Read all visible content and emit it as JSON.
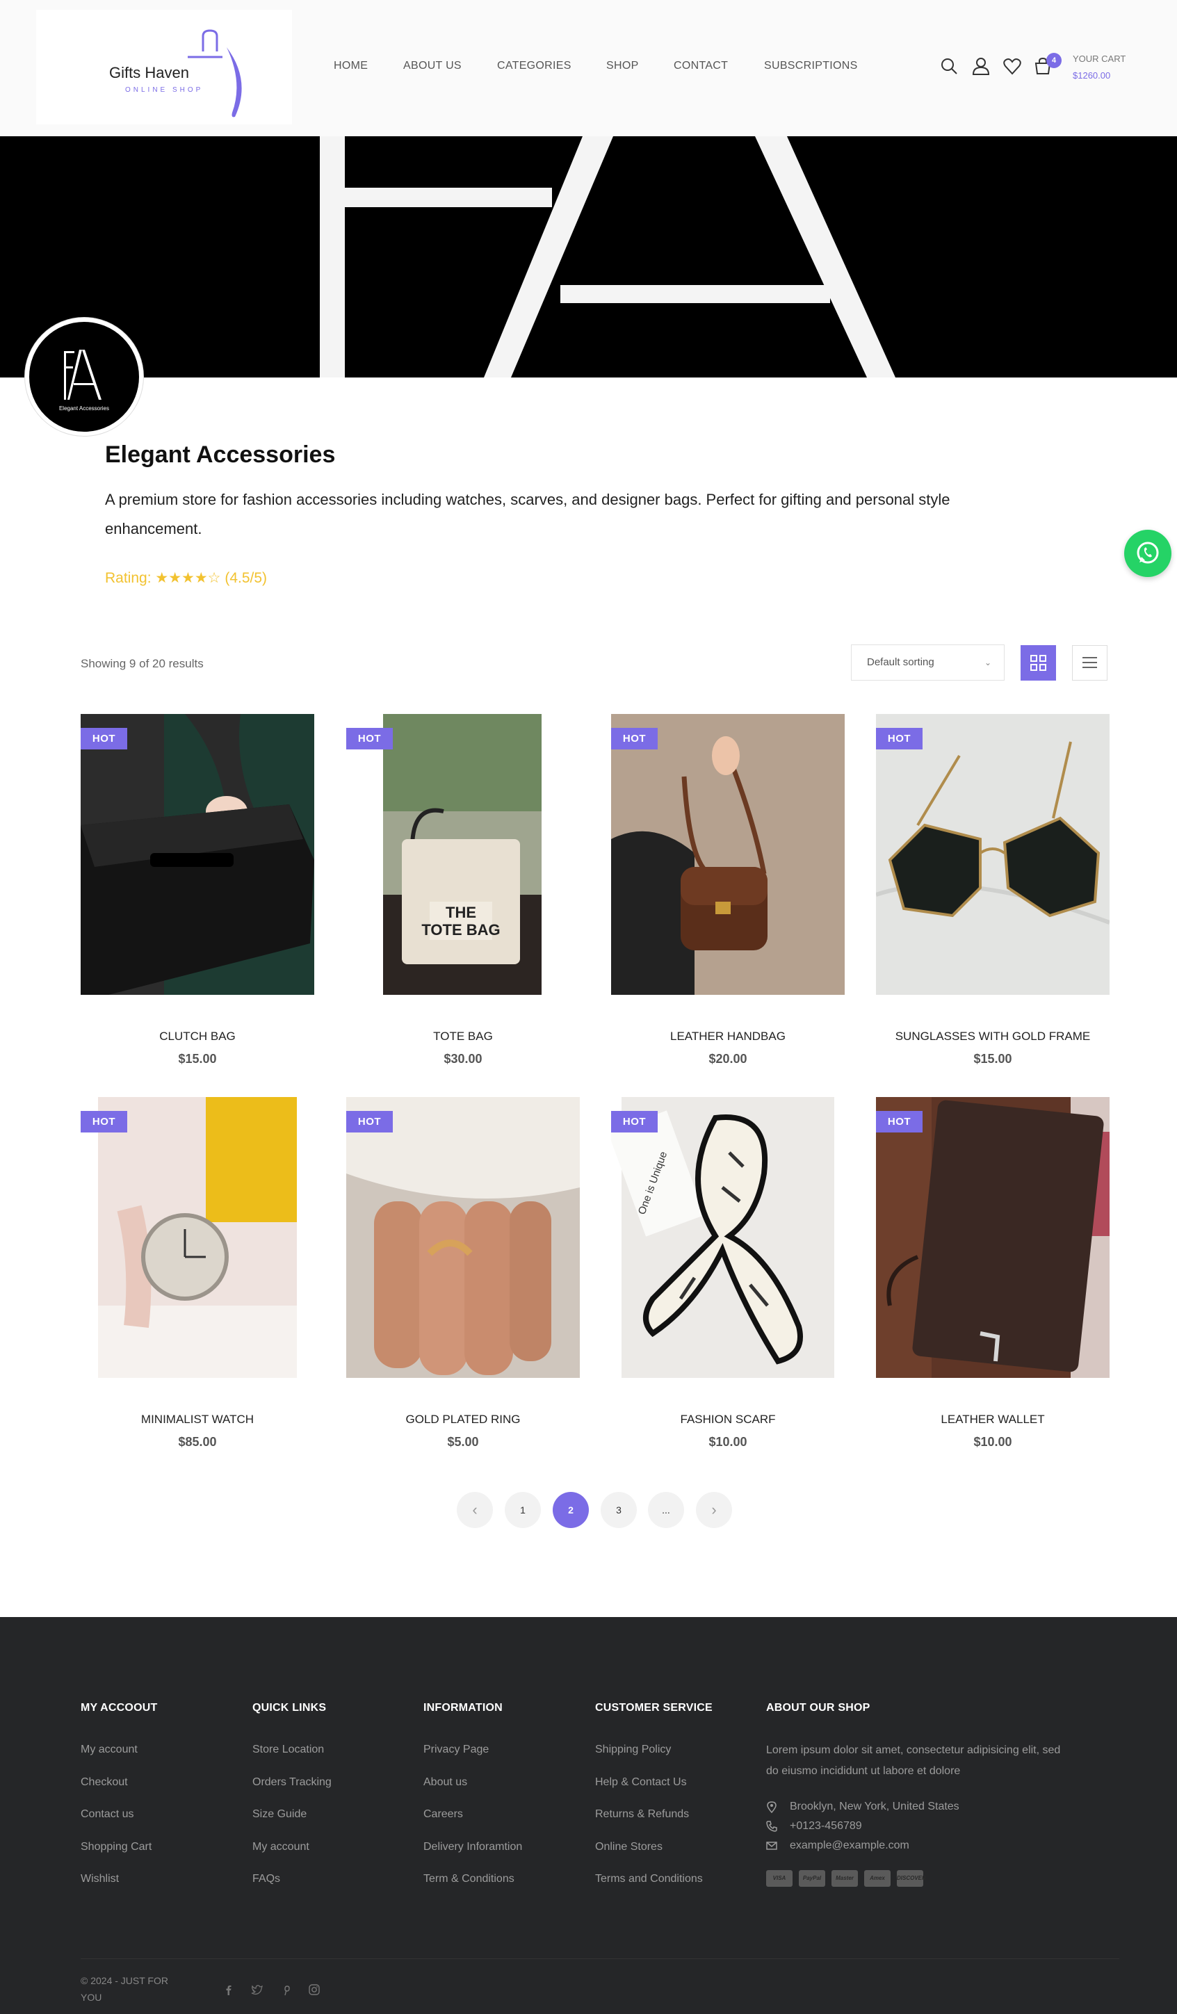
{
  "header": {
    "logo_title": "Gifts Haven",
    "logo_subtitle": "ONLINE SHOP",
    "nav": [
      "HOME",
      "ABOUT US",
      "CATEGORIES",
      "SHOP",
      "CONTACT",
      "SUBSCRIPTIONS"
    ],
    "icons": [
      "search-icon",
      "user-icon",
      "heart-icon",
      "cart-icon"
    ],
    "cart_count": "4",
    "cart_label": "YOUR CART",
    "cart_total": "$1260.00"
  },
  "store": {
    "name": "Elegant Accessories",
    "description": "A premium store for fashion accessories including watches, scarves, and designer bags. Perfect for gifting and personal style enhancement.",
    "rating": "Rating: ★★★★☆ (4.5/5)",
    "avatar_caption": "Elegant Accessories"
  },
  "toolbar": {
    "result_count": "Showing 9 of 20 results",
    "sort_value": "Default sorting",
    "view_modes": [
      "grid-view-icon",
      "list-view-icon"
    ],
    "active_view": "grid"
  },
  "products": [
    {
      "badge": "HOT",
      "name": "CLUTCH BAG",
      "price": "$15.00"
    },
    {
      "badge": "HOT",
      "name": "TOTE BAG",
      "price": "$30.00",
      "image_text": "THE TOTE BAG"
    },
    {
      "badge": "HOT",
      "name": "LEATHER HANDBAG",
      "price": "$20.00"
    },
    {
      "badge": "HOT",
      "name": "SUNGLASSES WITH GOLD FRAME",
      "price": "$15.00"
    },
    {
      "badge": "HOT",
      "name": "MINIMALIST WATCH",
      "price": "$85.00"
    },
    {
      "badge": "HOT",
      "name": "GOLD PLATED RING",
      "price": "$5.00"
    },
    {
      "badge": "HOT",
      "name": "FASHION SCARF",
      "price": "$10.00",
      "image_text": "One is Unique"
    },
    {
      "badge": "HOT",
      "name": "LEATHER WALLET",
      "price": "$10.00"
    }
  ],
  "pagination": {
    "prev": "‹",
    "pages": [
      "1",
      "2",
      "3",
      "..."
    ],
    "current": "2",
    "next": "›"
  },
  "footer": {
    "columns": [
      {
        "title": "MY ACCOOUT",
        "links": [
          "My account",
          "Checkout",
          "Contact us",
          "Shopping Cart",
          "Wishlist"
        ]
      },
      {
        "title": "QUICK LINKS",
        "links": [
          "Store Location",
          "Orders Tracking",
          "Size Guide",
          "My account",
          "FAQs"
        ]
      },
      {
        "title": "INFORMATION",
        "links": [
          "Privacy Page",
          "About us",
          "Careers",
          "Delivery Inforamtion",
          "Term & Conditions"
        ]
      },
      {
        "title": "CUSTOMER SERVICE",
        "links": [
          "Shipping Policy",
          "Help & Contact Us",
          "Returns & Refunds",
          "Online Stores",
          "Terms and Conditions"
        ]
      }
    ],
    "about": {
      "title": "ABOUT OUR SHOP",
      "text": "Lorem ipsum dolor sit amet, consectetur adipisicing elit, sed do eiusmo incididunt ut labore et dolore",
      "address": "Brooklyn, New York, United States",
      "phone": "+0123-456789",
      "email": "example@example.com",
      "payments": [
        "VISA",
        "PayPal",
        "Master",
        "Amex",
        "DISCOVER"
      ]
    },
    "copyright": "© 2024 - JUST FOR YOU",
    "social": [
      "facebook-icon",
      "twitter-icon",
      "pinterest-icon",
      "instagram-icon"
    ]
  },
  "colors": {
    "accent": "#7b6ce6",
    "footer_bg": "#252628",
    "rating": "#f2c230",
    "whatsapp": "#25d366"
  }
}
